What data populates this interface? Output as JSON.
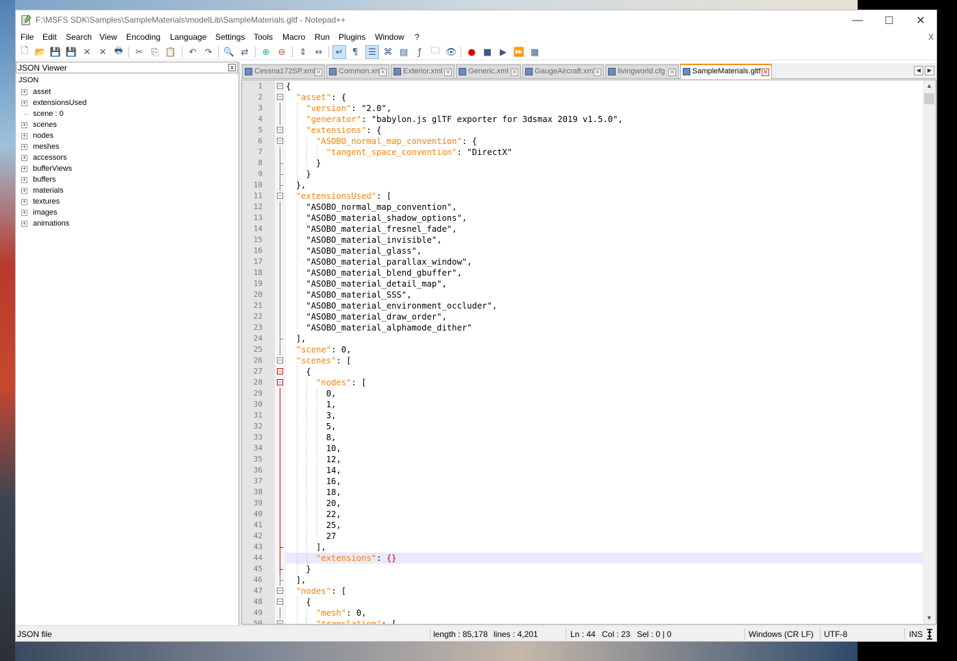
{
  "window": {
    "title": "F:\\MSFS SDK\\Samples\\SampleMaterials\\modelLib\\SampleMaterials.gltf - Notepad++",
    "minimize_glyph": "—",
    "maximize_glyph": "☐",
    "close_glyph": "✕"
  },
  "menu": [
    "File",
    "Edit",
    "Search",
    "View",
    "Encoding",
    "Language",
    "Settings",
    "Tools",
    "Macro",
    "Run",
    "Plugins",
    "Window",
    "?"
  ],
  "menu_close": "X",
  "toolbar": [
    "new-file-icon",
    "open-file-icon",
    "save-icon",
    "save-all-icon",
    "close-icon",
    "close-all-icon",
    "print-icon",
    "cut-icon",
    "copy-icon",
    "paste-icon",
    "undo-icon",
    "redo-icon",
    "find-icon",
    "replace-icon",
    "zoom-in-icon",
    "zoom-out-icon",
    "sync-vertical-icon",
    "sync-horizontal-icon",
    "word-wrap-icon",
    "show-all-characters-icon",
    "indent-guide-icon",
    "define-language-icon",
    "document-map-icon",
    "function-list-icon",
    "folder-workspace-icon",
    "monitoring-icon",
    "record-macro-icon",
    "stop-macro-icon",
    "play-macro-icon",
    "run-macro-multiple-icon",
    "save-macro-icon"
  ],
  "json_viewer": {
    "title": "JSON Viewer",
    "close_glyph": "x",
    "root": "JSON",
    "nodes": [
      {
        "label": "asset",
        "expandable": true
      },
      {
        "label": "extensionsUsed",
        "expandable": true
      },
      {
        "label": "scene : 0",
        "expandable": false
      },
      {
        "label": "scenes",
        "expandable": true
      },
      {
        "label": "nodes",
        "expandable": true
      },
      {
        "label": "meshes",
        "expandable": true
      },
      {
        "label": "accessors",
        "expandable": true
      },
      {
        "label": "bufferViews",
        "expandable": true
      },
      {
        "label": "buffers",
        "expandable": true
      },
      {
        "label": "materials",
        "expandable": true
      },
      {
        "label": "textures",
        "expandable": true
      },
      {
        "label": "images",
        "expandable": true
      },
      {
        "label": "animations",
        "expandable": true
      }
    ]
  },
  "tabs": [
    {
      "label": "Cessna172SP.xml",
      "active": false
    },
    {
      "label": "Common.xml",
      "active": false
    },
    {
      "label": "Exterior.xml",
      "active": false
    },
    {
      "label": "Generic.xml",
      "active": false
    },
    {
      "label": "GaugeAircraft.xml",
      "active": false
    },
    {
      "label": "livingworld.cfg",
      "active": false
    },
    {
      "label": "SampleMaterials.gltf",
      "active": true
    }
  ],
  "editor": {
    "current_line": 44,
    "lines": [
      {
        "n": 1,
        "i": 0,
        "t": [
          {
            "s": "{"
          }
        ],
        "f": "open"
      },
      {
        "n": 2,
        "i": 1,
        "t": [
          {
            "s": "\"asset\"",
            "k": 1
          },
          {
            "s": ": {"
          }
        ],
        "f": "open"
      },
      {
        "n": 3,
        "i": 2,
        "t": [
          {
            "s": "\"version\"",
            "k": 1
          },
          {
            "s": ": \"2.0\","
          }
        ],
        "f": "line"
      },
      {
        "n": 4,
        "i": 2,
        "t": [
          {
            "s": "\"generator\"",
            "k": 1
          },
          {
            "s": ": \"babylon.js glTF exporter for 3dsmax 2019 v1.5.0\","
          }
        ],
        "f": "line"
      },
      {
        "n": 5,
        "i": 2,
        "t": [
          {
            "s": "\"extensions\"",
            "k": 1
          },
          {
            "s": ": {"
          }
        ],
        "f": "open"
      },
      {
        "n": 6,
        "i": 3,
        "t": [
          {
            "s": "\"ASOBO_normal_map_convention\"",
            "k": 1
          },
          {
            "s": ": {"
          }
        ],
        "f": "open"
      },
      {
        "n": 7,
        "i": 4,
        "t": [
          {
            "s": "\"tangent_space_convention\"",
            "k": 1
          },
          {
            "s": ": \"DirectX\""
          }
        ],
        "f": "line"
      },
      {
        "n": 8,
        "i": 3,
        "t": [
          {
            "s": "}"
          }
        ],
        "f": "end"
      },
      {
        "n": 9,
        "i": 2,
        "t": [
          {
            "s": "}"
          }
        ],
        "f": "end"
      },
      {
        "n": 10,
        "i": 1,
        "t": [
          {
            "s": "},"
          }
        ],
        "f": "end"
      },
      {
        "n": 11,
        "i": 1,
        "t": [
          {
            "s": "\"extensionsUsed\"",
            "k": 1
          },
          {
            "s": ": ["
          }
        ],
        "f": "open"
      },
      {
        "n": 12,
        "i": 2,
        "t": [
          {
            "s": "\"ASOBO_normal_map_convention\","
          }
        ],
        "f": "line"
      },
      {
        "n": 13,
        "i": 2,
        "t": [
          {
            "s": "\"ASOBO_material_shadow_options\","
          }
        ],
        "f": "line"
      },
      {
        "n": 14,
        "i": 2,
        "t": [
          {
            "s": "\"ASOBO_material_fresnel_fade\","
          }
        ],
        "f": "line"
      },
      {
        "n": 15,
        "i": 2,
        "t": [
          {
            "s": "\"ASOBO_material_invisible\","
          }
        ],
        "f": "line"
      },
      {
        "n": 16,
        "i": 2,
        "t": [
          {
            "s": "\"ASOBO_material_glass\","
          }
        ],
        "f": "line"
      },
      {
        "n": 17,
        "i": 2,
        "t": [
          {
            "s": "\"ASOBO_material_parallax_window\","
          }
        ],
        "f": "line"
      },
      {
        "n": 18,
        "i": 2,
        "t": [
          {
            "s": "\"ASOBO_material_blend_gbuffer\","
          }
        ],
        "f": "line"
      },
      {
        "n": 19,
        "i": 2,
        "t": [
          {
            "s": "\"ASOBO_material_detail_map\","
          }
        ],
        "f": "line"
      },
      {
        "n": 20,
        "i": 2,
        "t": [
          {
            "s": "\"ASOBO_material_SSS\","
          }
        ],
        "f": "line"
      },
      {
        "n": 21,
        "i": 2,
        "t": [
          {
            "s": "\"ASOBO_material_environment_occluder\","
          }
        ],
        "f": "line"
      },
      {
        "n": 22,
        "i": 2,
        "t": [
          {
            "s": "\"ASOBO_material_draw_order\","
          }
        ],
        "f": "line"
      },
      {
        "n": 23,
        "i": 2,
        "t": [
          {
            "s": "\"ASOBO_material_alphamode_dither\""
          }
        ],
        "f": "line"
      },
      {
        "n": 24,
        "i": 1,
        "t": [
          {
            "s": "],"
          }
        ],
        "f": "end"
      },
      {
        "n": 25,
        "i": 1,
        "t": [
          {
            "s": "\"scene\"",
            "k": 1
          },
          {
            "s": ": 0,"
          }
        ],
        "f": "line"
      },
      {
        "n": 26,
        "i": 1,
        "t": [
          {
            "s": "\"scenes\"",
            "k": 1
          },
          {
            "s": ": ["
          }
        ],
        "f": "open"
      },
      {
        "n": 27,
        "i": 2,
        "t": [
          {
            "s": "{"
          }
        ],
        "f": "open-red"
      },
      {
        "n": 28,
        "i": 3,
        "t": [
          {
            "s": "\"nodes\"",
            "k": 1
          },
          {
            "s": ": ["
          }
        ],
        "f": "open-red"
      },
      {
        "n": 29,
        "i": 4,
        "t": [
          {
            "s": "0,"
          }
        ],
        "f": "red"
      },
      {
        "n": 30,
        "i": 4,
        "t": [
          {
            "s": "1,"
          }
        ],
        "f": "red"
      },
      {
        "n": 31,
        "i": 4,
        "t": [
          {
            "s": "3,"
          }
        ],
        "f": "red"
      },
      {
        "n": 32,
        "i": 4,
        "t": [
          {
            "s": "5,"
          }
        ],
        "f": "red"
      },
      {
        "n": 33,
        "i": 4,
        "t": [
          {
            "s": "8,"
          }
        ],
        "f": "red"
      },
      {
        "n": 34,
        "i": 4,
        "t": [
          {
            "s": "10,"
          }
        ],
        "f": "red"
      },
      {
        "n": 35,
        "i": 4,
        "t": [
          {
            "s": "12,"
          }
        ],
        "f": "red"
      },
      {
        "n": 36,
        "i": 4,
        "t": [
          {
            "s": "14,"
          }
        ],
        "f": "red"
      },
      {
        "n": 37,
        "i": 4,
        "t": [
          {
            "s": "16,"
          }
        ],
        "f": "red"
      },
      {
        "n": 38,
        "i": 4,
        "t": [
          {
            "s": "18,"
          }
        ],
        "f": "red"
      },
      {
        "n": 39,
        "i": 4,
        "t": [
          {
            "s": "20,"
          }
        ],
        "f": "red"
      },
      {
        "n": 40,
        "i": 4,
        "t": [
          {
            "s": "22,"
          }
        ],
        "f": "red"
      },
      {
        "n": 41,
        "i": 4,
        "t": [
          {
            "s": "25,"
          }
        ],
        "f": "red"
      },
      {
        "n": 42,
        "i": 4,
        "t": [
          {
            "s": "27"
          }
        ],
        "f": "red"
      },
      {
        "n": 43,
        "i": 3,
        "t": [
          {
            "s": "],"
          }
        ],
        "f": "end-red"
      },
      {
        "n": 44,
        "i": 3,
        "t": [
          {
            "s": "\"extensions\"",
            "k": 1
          },
          {
            "s": ": "
          },
          {
            "s": "{}",
            "b": 1
          }
        ],
        "f": "red"
      },
      {
        "n": 45,
        "i": 2,
        "t": [
          {
            "s": "}"
          }
        ],
        "f": "end-red"
      },
      {
        "n": 46,
        "i": 1,
        "t": [
          {
            "s": "],"
          }
        ],
        "f": "end"
      },
      {
        "n": 47,
        "i": 1,
        "t": [
          {
            "s": "\"nodes\"",
            "k": 1
          },
          {
            "s": ": ["
          }
        ],
        "f": "open"
      },
      {
        "n": 48,
        "i": 2,
        "t": [
          {
            "s": "{"
          }
        ],
        "f": "open"
      },
      {
        "n": 49,
        "i": 3,
        "t": [
          {
            "s": "\"mesh\"",
            "k": 1
          },
          {
            "s": ": 0,"
          }
        ],
        "f": "line"
      },
      {
        "n": 50,
        "i": 3,
        "t": [
          {
            "s": "\"translation\"",
            "k": 1
          },
          {
            "s": ": ["
          }
        ],
        "f": "open"
      }
    ]
  },
  "status": {
    "file_type": "JSON file",
    "length": "length : 85,178",
    "lines": "lines : 4,201",
    "ln": "Ln : 44",
    "col": "Col : 23",
    "sel": "Sel : 0 | 0",
    "eol": "Windows (CR LF)",
    "encoding": "UTF-8",
    "mode": "INS"
  },
  "colors": {
    "accent_tab": "#f58f23",
    "json_key": "#ff8000",
    "brace_match": "#dd0000",
    "current_line": "#e8e8ff"
  }
}
